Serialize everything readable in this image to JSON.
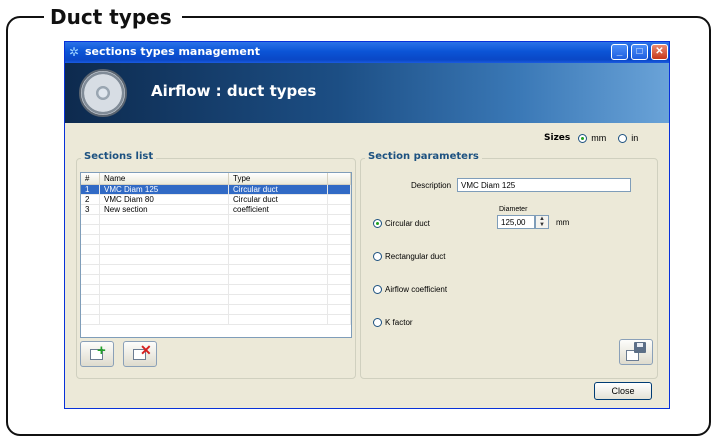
{
  "frame": {
    "title": "Duct types"
  },
  "window": {
    "title": "sections types management"
  },
  "banner": {
    "title": "Airflow : duct types"
  },
  "sizes": {
    "label": "Sizes",
    "options": [
      "mm",
      "in"
    ],
    "selected": "mm"
  },
  "sections_list": {
    "title": "Sections list",
    "columns": [
      "#",
      "Name",
      "Type"
    ],
    "rows": [
      {
        "num": "1",
        "name": "VMC Diam 125",
        "type": "Circular duct",
        "selected": true
      },
      {
        "num": "2",
        "name": "VMC Diam 80",
        "type": "Circular duct",
        "selected": false
      },
      {
        "num": "3",
        "name": "New section",
        "type": "coefficient",
        "selected": false
      }
    ]
  },
  "section_parameters": {
    "title": "Section parameters",
    "description_label": "Description",
    "description_value": "VMC Diam 125",
    "diameter_label": "Diameter",
    "diameter_value": "125,00",
    "diameter_unit": "mm",
    "types": [
      "Circular duct",
      "Rectangular duct",
      "Airflow coefficient",
      "K factor"
    ],
    "selected_type": "Circular duct"
  },
  "buttons": {
    "close": "Close"
  },
  "icons": {
    "add": "add-section-icon",
    "delete": "delete-section-icon",
    "save": "save-icon"
  }
}
